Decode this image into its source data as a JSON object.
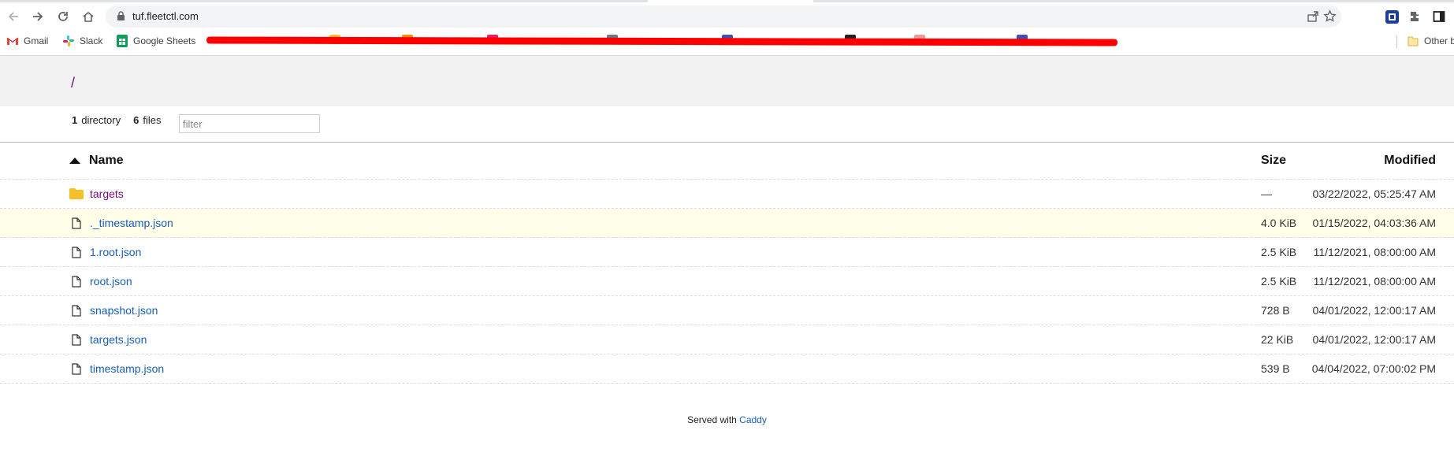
{
  "browser": {
    "url": "tuf.fleetctl.com",
    "bookmarks": [
      {
        "label": "Gmail",
        "icon": "gmail-icon"
      },
      {
        "label": "Slack",
        "icon": "slack-icon"
      },
      {
        "label": "Google Sheets",
        "icon": "sheets-icon"
      }
    ],
    "other_bookmarks": "Other b"
  },
  "listing": {
    "path": "/",
    "dir_count": "1",
    "dir_label": "directory",
    "file_count": "6",
    "file_label": "files",
    "filter_placeholder": "filter",
    "columns": {
      "name": "Name",
      "size": "Size",
      "modified": "Modified"
    },
    "rows": [
      {
        "name": "targets",
        "type": "folder",
        "size": "—",
        "modified": "03/22/2022, 05:25:47 AM"
      },
      {
        "name": "._timestamp.json",
        "type": "file",
        "size": "4.0 KiB",
        "modified": "01/15/2022, 04:03:36 AM"
      },
      {
        "name": "1.root.json",
        "type": "file",
        "size": "2.5 KiB",
        "modified": "11/12/2021, 08:00:00 AM"
      },
      {
        "name": "root.json",
        "type": "file",
        "size": "2.5 KiB",
        "modified": "11/12/2021, 08:00:00 AM"
      },
      {
        "name": "snapshot.json",
        "type": "file",
        "size": "728 B",
        "modified": "04/01/2022, 12:00:17 AM"
      },
      {
        "name": "targets.json",
        "type": "file",
        "size": "22 KiB",
        "modified": "04/01/2022, 12:00:17 AM"
      },
      {
        "name": "timestamp.json",
        "type": "file",
        "size": "539 B",
        "modified": "04/04/2022, 07:00:02 PM"
      }
    ]
  },
  "footer": {
    "prefix": "Served with",
    "link": "Caddy"
  },
  "colors": {
    "dir_link": "#7a0a7e",
    "file_link": "#1a5fb4",
    "highlight_row": "#ffffe9",
    "redaction": "#ff0000"
  }
}
